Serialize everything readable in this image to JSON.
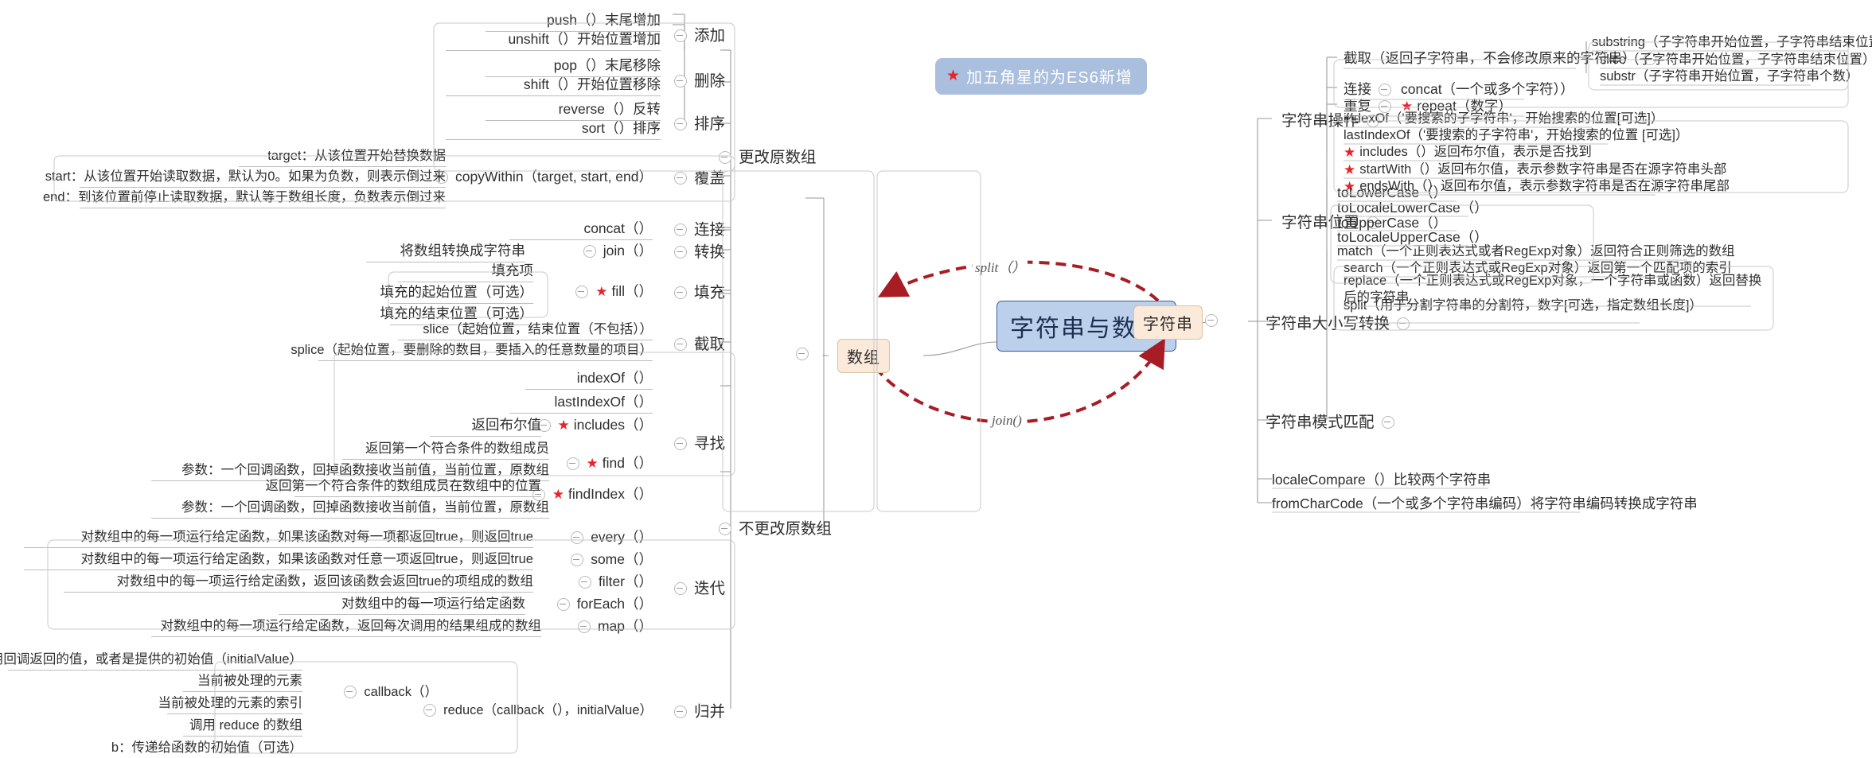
{
  "legend": {
    "text": "加五角星的为ES6新增",
    "star": "★",
    "bg": "#aabedd",
    "star_color": "#e8232a"
  },
  "central": {
    "title": "字符串与数组",
    "bg": "#bcd0ec",
    "border": "#3d5f9b"
  },
  "relations": {
    "split_label": "split（）",
    "join_label": "join()",
    "color": "#a81c24"
  },
  "branches": {
    "array": {
      "label": "数组"
    },
    "string": {
      "label": "字符串"
    }
  },
  "array": {
    "mutating": {
      "label": "更改原数组"
    },
    "non_mutating": {
      "label": "不更改原数组"
    },
    "groups": {
      "add": {
        "label": "添加",
        "items": [
          "push（）末尾增加",
          "unshift（）开始位置增加"
        ]
      },
      "remove": {
        "label": "删除",
        "items": [
          "pop（）末尾移除",
          "shift（）开始位置移除"
        ]
      },
      "sort": {
        "label": "排序",
        "items": [
          "reverse（）反转",
          "sort（）排序"
        ]
      },
      "overwrite": {
        "label": "覆盖",
        "method": "copyWithin（target, start, end）",
        "params": [
          "target：从该位置开始替换数据",
          "start：从该位置开始读取数据，默认为0。如果为负数，则表示倒过来",
          "end：到该位置前停止读取数据，默认等于数组长度，负数表示倒过来"
        ]
      },
      "concat": {
        "label": "连接",
        "method": "concat（）"
      },
      "convert": {
        "label": "转换",
        "method": "join（）",
        "desc": "将数组转换成字符串"
      },
      "fill": {
        "label": "填充",
        "method": "fill（）",
        "star": true,
        "params": [
          "填充项",
          "填充的起始位置（可选）",
          "填充的结束位置（可选）"
        ]
      },
      "extract": {
        "label": "截取",
        "items": [
          "slice（起始位置，结束位置（不包括））",
          "splice（起始位置，要删除的数目，要插入的任意数量的项目）"
        ]
      },
      "find": {
        "label": "寻找",
        "items": [
          {
            "method": "indexOf（）",
            "star": false,
            "desc": null
          },
          {
            "method": "lastIndexOf（）",
            "star": false,
            "desc": null
          },
          {
            "method": "includes（）",
            "star": true,
            "desc": "返回布尔值"
          },
          {
            "method": "find（）",
            "star": true,
            "desc": "返回第一个符合条件的数组成员",
            "param": "参数：一个回调函数，回掉函数接收当前值，当前位置，原数组"
          },
          {
            "method": "findIndex（）",
            "star": true,
            "desc": "返回第一个符合条件的数组成员在数组中的位置",
            "param": "参数：一个回调函数，回掉函数接收当前值，当前位置，原数组"
          }
        ]
      },
      "iterate": {
        "label": "迭代",
        "items": [
          {
            "method": "every（）",
            "desc": "对数组中的每一项运行给定函数，如果该函数对每一项都返回true，则返回true"
          },
          {
            "method": "some（）",
            "desc": "对数组中的每一项运行给定函数，如果该函数对任意一项返回true，则返回true"
          },
          {
            "method": "filter（）",
            "desc": "对数组中的每一项运行给定函数，返回该函数会返回true的项组成的数组"
          },
          {
            "method": "forEach（）",
            "desc": "对数组中的每一项运行给定函数"
          },
          {
            "method": "map（）",
            "desc": "对数组中的每一项运行给定函数，返回每次调用的结果组成的数组"
          }
        ]
      },
      "reduce": {
        "label": "归并",
        "method": "reduce（callback（），initialValue）",
        "callback": {
          "label": "callback（）",
          "params": [
            "上一次调用回调返回的值，或者是提供的初始值（initialValue）",
            "当前被处理的元素",
            "当前被处理的元素的索引",
            "调用 reduce 的数组"
          ]
        },
        "b_param": "b：传递给函数的初始值（可选）"
      }
    }
  },
  "string": {
    "groups": {
      "operation": {
        "label": "字符串操作",
        "items": [
          {
            "label": "截取（返回子字符串，不会修改原来的字符串）",
            "children": [
              "substring（子字符串开始位置，子字符串结束位置）",
              "slice（子字符串开始位置，子字符串结束位置）",
              "substr（子字符串开始位置，子字符串个数）"
            ]
          },
          {
            "label": "连接",
            "method": "concat（一个或多个字符））",
            "star": false
          },
          {
            "label": "重复",
            "method": "repeat（数字）",
            "star": true
          }
        ]
      },
      "position": {
        "label": "字符串位置",
        "items": [
          {
            "text": "indexOf（'要搜索的子字符串'，开始搜索的位置[可选]）",
            "star": false
          },
          {
            "text": "lastIndexOf（'要搜索的子字符串'，开始搜索的位置 [可选]）",
            "star": false
          },
          {
            "text": "includes（）返回布尔值，表示是否找到",
            "star": true
          },
          {
            "text": "startWith（）返回布尔值，表示参数字符串是否在源字符串头部",
            "star": true
          },
          {
            "text": "endsWith（）返回布尔值，表示参数字符串是否在源字符串尾部",
            "star": true
          }
        ]
      },
      "case": {
        "label": "字符串大小写转换",
        "items": [
          "toLowerCase（）",
          "toLocaleLowerCase（）",
          "toUpperCase（）",
          "toLocaleUpperCase（）"
        ]
      },
      "pattern": {
        "label": "字符串模式匹配",
        "items": [
          "match（一个正则表达式或者RegExp对象）返回符合正则筛选的数组",
          "search（一个正则表达式或RegExp对象）返回第一个匹配项的索引",
          "replace（一个正则表达式或RegExp对象，一个字符串或函数）返回替换后的字符串",
          "split（用于分割字符串的分割符，数字[可选，指定数组长度]）"
        ]
      },
      "locale_compare": "localeCompare（）比较两个字符串",
      "from_char_code": "fromCharCode（一个或多个字符串编码）将字符串编码转换成字符串"
    }
  }
}
